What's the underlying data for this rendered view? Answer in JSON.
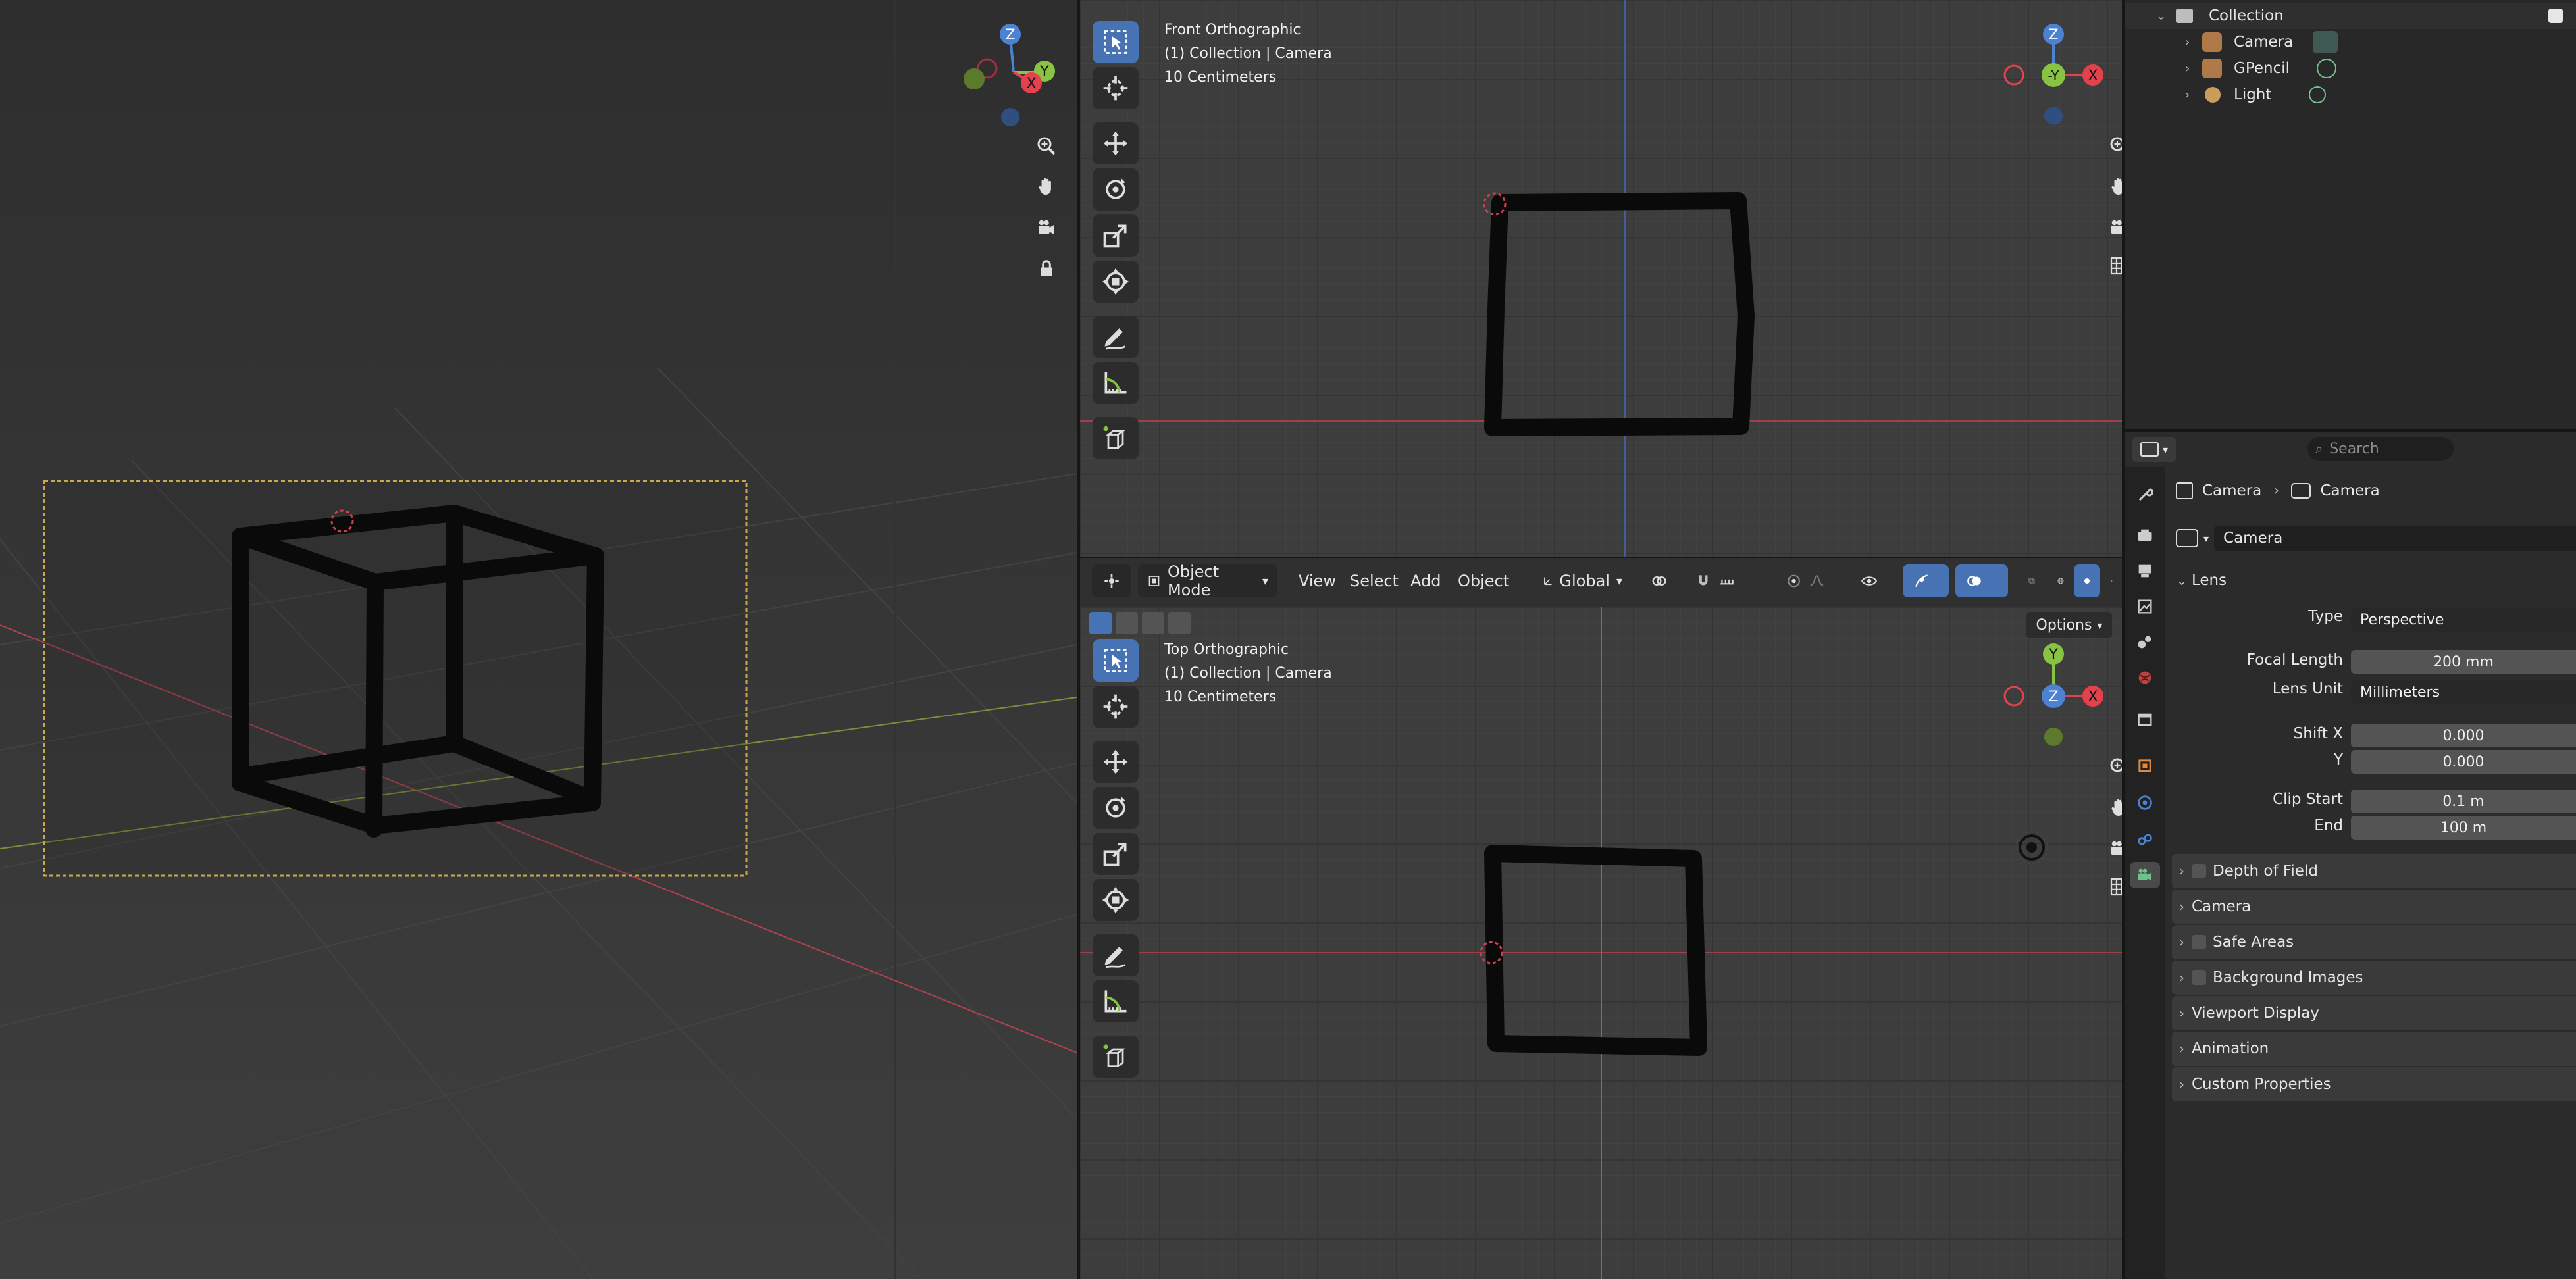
{
  "front_view": {
    "title": "Front Orthographic",
    "collection": "(1) Collection | Camera",
    "scale": "10 Centimeters"
  },
  "top_view": {
    "title": "Top Orthographic",
    "collection": "(1) Collection | Camera",
    "scale": "10 Centimeters",
    "options_label": "Options"
  },
  "header": {
    "mode": "Object Mode",
    "menus": [
      "View",
      "Select",
      "Add",
      "Object"
    ],
    "transform_orientation": "Global"
  },
  "gizmo": {
    "x": "X",
    "y": "Y",
    "z": "Z",
    "neg_y": "-Y"
  },
  "outliner": {
    "collection": "Collection",
    "items": [
      "Camera",
      "GPencil",
      "Light"
    ]
  },
  "properties": {
    "search_placeholder": "Search",
    "breadcrumb": [
      "Camera",
      "Camera"
    ],
    "datablock_name": "Camera",
    "lens_panel": "Lens",
    "type_label": "Type",
    "type_value": "Perspective",
    "focal_length_label": "Focal Length",
    "focal_length_value": "200 mm",
    "lens_unit_label": "Lens Unit",
    "lens_unit_value": "Millimeters",
    "shift_x_label": "Shift X",
    "shift_x_value": "0.000",
    "shift_y_label": "Y",
    "shift_y_value": "0.000",
    "clip_start_label": "Clip Start",
    "clip_start_value": "0.1 m",
    "clip_end_label": "End",
    "clip_end_value": "100 m",
    "panels": [
      "Depth of Field",
      "Camera",
      "Safe Areas",
      "Background Images",
      "Viewport Display",
      "Animation",
      "Custom Properties"
    ]
  },
  "colors": {
    "accent": "#4772b3",
    "axis_x": "#e3424d",
    "axis_y": "#88c341",
    "axis_z": "#4b82d1",
    "camera_frame": "#c9a94a"
  }
}
